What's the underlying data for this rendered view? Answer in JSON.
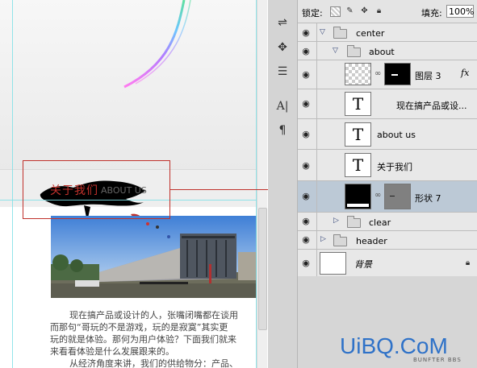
{
  "canvas": {
    "title_zh": "关于我们",
    "title_en": "ABOUT US",
    "paragraphs": [
      "现在搞产品或设计的人，张嘴闭嘴都在谈用",
      "而那句“哥玩的不是游戏，玩的是寂寞”其实更",
      "玩的就是体验。那何为用户体验？下面我们就来",
      "来看看体验是什么发展跟来的。",
      "从经济角度来讲，我们的供给物分：产品、"
    ]
  },
  "tools": [
    {
      "icon": "adjust-icon",
      "glyph": "⇌"
    },
    {
      "icon": "puppet-icon",
      "glyph": "✥"
    },
    {
      "icon": "layer-comps-icon",
      "glyph": "☰"
    },
    {
      "icon": "character-icon",
      "glyph": "A|"
    },
    {
      "icon": "paragraph-icon",
      "glyph": "¶"
    }
  ],
  "lock": {
    "label": "锁定:",
    "fill_label": "填充:",
    "fill_value": "100%",
    "icons": [
      "lock-transparent-icon",
      "lock-brush-icon",
      "lock-move-icon",
      "lock-all-icon"
    ]
  },
  "layers": [
    {
      "name": "center",
      "type": "group",
      "expanded": true
    },
    {
      "name": "about",
      "type": "group",
      "expanded": true
    },
    {
      "name": "图层 3",
      "type": "masked",
      "fx": "fx"
    },
    {
      "name": "现在搞产品或设...",
      "type": "text",
      "glyph": "T"
    },
    {
      "name": "about us",
      "type": "text",
      "glyph": "T"
    },
    {
      "name": "关于我们",
      "type": "text",
      "glyph": "T"
    },
    {
      "name": "形状 7",
      "type": "shape",
      "selected": true
    },
    {
      "name": "clear",
      "type": "group",
      "expanded": false
    },
    {
      "name": "header",
      "type": "group",
      "expanded": false
    },
    {
      "name": "背景",
      "type": "background"
    }
  ],
  "watermark": {
    "text": "UiBQ.CoM",
    "sub": "BUNFTER BBS"
  },
  "colors": {
    "accent_red": "#c0312b",
    "selection": "#bcc9d6",
    "watermark": "#2f72c8"
  }
}
